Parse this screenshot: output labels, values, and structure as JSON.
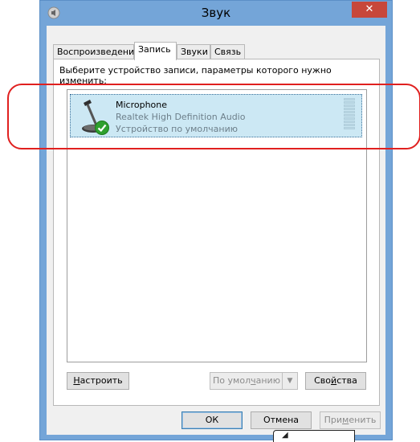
{
  "window": {
    "title": "Звук",
    "close_label": "✕"
  },
  "tabs": [
    {
      "label": "Воспроизведение"
    },
    {
      "label": "Запись"
    },
    {
      "label": "Звуки"
    },
    {
      "label": "Связь"
    }
  ],
  "panel": {
    "instruction": "Выберите устройство записи, параметры которого нужно изменить:"
  },
  "devices": [
    {
      "name": "Microphone",
      "driver": "Realtek High Definition Audio",
      "status": "Устройство по умолчанию",
      "icon": "microphone-icon",
      "default_badge": "green-check-icon"
    }
  ],
  "buttons": {
    "configure_u": "Н",
    "configure_rest": "астроить",
    "set_default_a": "По умол",
    "set_default_u": "ч",
    "set_default_b": "анию",
    "properties_a": "Сво",
    "properties_u": "й",
    "properties_b": "ства",
    "ok": "ОК",
    "cancel": "Отмена",
    "apply_a": "При",
    "apply_u": "м",
    "apply_b": "енить"
  },
  "colors": {
    "highlight": "#e0201f",
    "selection": "#cce8f4",
    "titlebar": "#74a5d8",
    "close": "#c7473a"
  }
}
